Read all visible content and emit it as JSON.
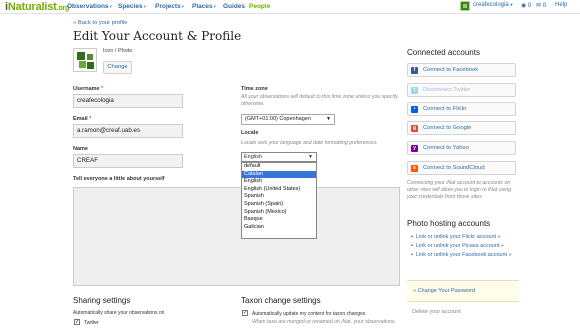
{
  "header": {
    "logo": {
      "i": "i",
      "main": "Naturalist",
      "suffix": ".org"
    },
    "nav": [
      "Observations",
      "Species",
      "Projects",
      "Places",
      "Guides",
      "People"
    ],
    "caret": "▾",
    "user": "creafecologia",
    "notifications": "0",
    "messages": "0",
    "help": "Help"
  },
  "back_link": "« Back to your profile",
  "page_title": "Edit Your Account & Profile",
  "icon_label": "Icon / Photo",
  "change_button": "Change",
  "username": {
    "label": "Username",
    "required": "*",
    "value": "creafecologia"
  },
  "email": {
    "label": "Email",
    "required": "*",
    "value": "a.ramon@creaf.uab.es"
  },
  "name": {
    "label": "Name",
    "value": "CREAF"
  },
  "bio_label": "Tell everyone a little about yourself",
  "time_zone": {
    "label": "Time zone",
    "note": "All your observations will default to this time zone unless you specify otherwise.",
    "value": "(GMT+01:00) Copenhagen"
  },
  "locale": {
    "label": "Locale",
    "note": "Locale sets your language and date formatting preferences.",
    "value": "English",
    "options": [
      "default",
      "Catalan",
      "English",
      "English (United States)",
      "Spanish",
      "Spanish (Spain)",
      "Spanish (Mexico)",
      "Basque",
      "Galician"
    ],
    "highlighted": "Catalan"
  },
  "sharing": {
    "title": "Sharing settings",
    "desc": "Automatically share your observations on",
    "twitter": "Twitter",
    "check": "✓"
  },
  "taxon_change": {
    "title": "Taxon change settings",
    "option": "Automatically update my content for taxon changes",
    "note": "When taxa are merged or renamed on iNat, your observations,",
    "check": "✓"
  },
  "connected": {
    "title": "Connected accounts",
    "buttons": [
      {
        "label": "Connect to Facebook",
        "icon": "f",
        "color": "#3b5998"
      },
      {
        "label": "Disconnect Twitter",
        "icon": "t",
        "color": "#9fd6ee"
      },
      {
        "label": "Connect to Flickr",
        "icon": "•",
        "color": "#0063dc"
      },
      {
        "label": "Connect to Google",
        "icon": "g",
        "color": "#dd4b39"
      },
      {
        "label": "Connect to Yahoo",
        "icon": "y",
        "color": "#7b0099"
      },
      {
        "label": "Connect to SoundCloud",
        "icon": "s",
        "color": "#ff5500"
      }
    ],
    "note": "Connecting your iNat account to accounts on other sites will allow you to login to iNat using your credentials from those sites."
  },
  "photo_hosting": {
    "title": "Photo hosting accounts",
    "links": [
      "Link or unlink your Flickr account »",
      "Link or unlink your Picasa account »",
      "Link or unlink your Facebook account »"
    ]
  },
  "change_password": "» Change Your Password",
  "delete_account": "Delete your account"
}
